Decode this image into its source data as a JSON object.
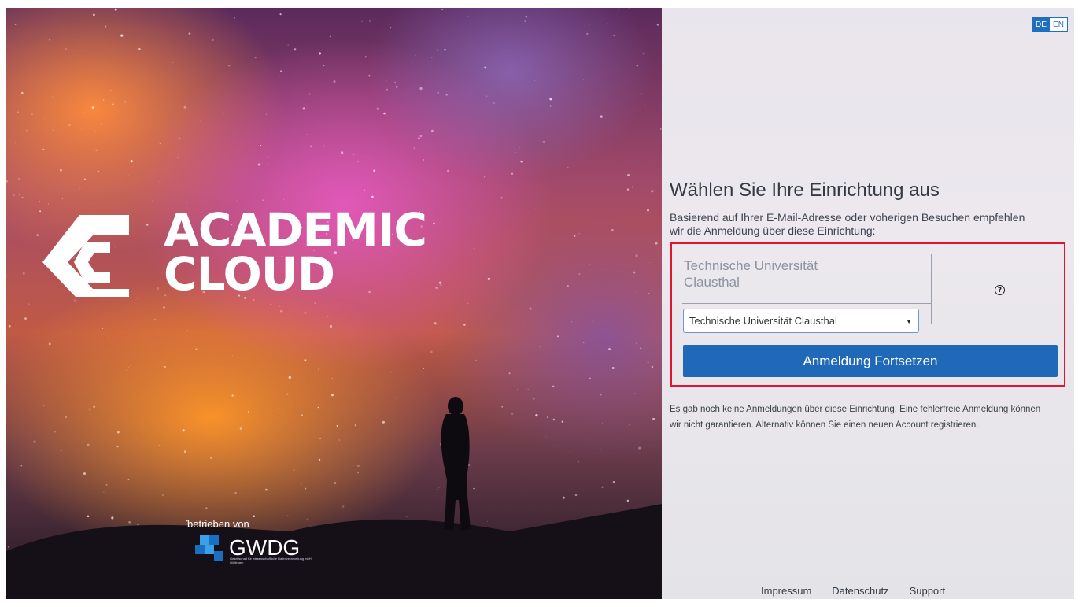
{
  "hero": {
    "brand_line1": "ACADEMIC",
    "brand_line2": "CLOUD",
    "operated_by_label": "betrieben von",
    "operator_name": "GWDG",
    "operator_subtitle": "Gesellschaft für wissenschaftliche Datenverarbeitung mbH Göttingen",
    "logo_icon": "academic-cloud-logo-icon",
    "operator_icon": "gwdg-logo-icon"
  },
  "language": {
    "options": [
      "DE",
      "EN"
    ],
    "selected": "DE",
    "accent_color": "#1f6fbf"
  },
  "form": {
    "heading": "Wählen Sie Ihre Einrichtung aus",
    "subtext": "Basierend auf Ihrer E-Mail-Adresse oder voherigen Besuchen empfehlen wir die Anmeldung über diese Einrichtung:",
    "selected_institution_display": "Technische Universität Clausthal",
    "select_value": "Technische Universität Clausthal",
    "help_icon": "question-circle-icon",
    "submit_label": "Anmeldung Fortsetzen",
    "submit_color": "#1f69b8",
    "highlight_color": "#e1162e"
  },
  "notice": {
    "text": "Es gab noch keine Anmeldungen über diese Einrichtung. Eine fehlerfreie Anmeldung können wir nicht garantieren. Alternativ können Sie einen neuen Account registrieren."
  },
  "footer": {
    "links": [
      "Impressum",
      "Datenschutz",
      "Support"
    ]
  }
}
